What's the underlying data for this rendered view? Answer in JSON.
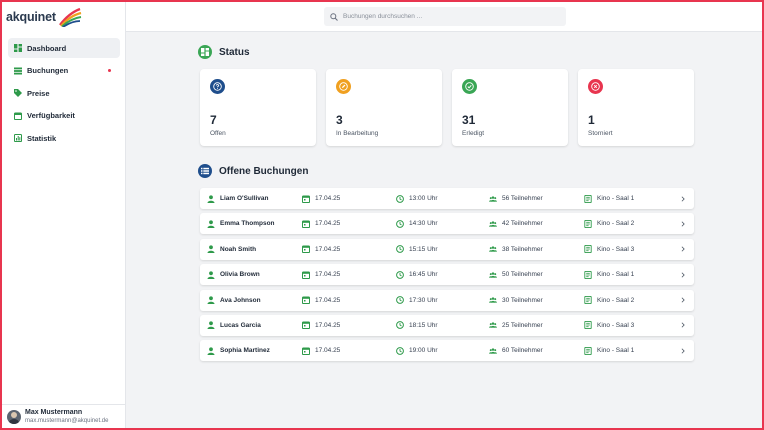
{
  "app": {
    "logo_text": "akquinet"
  },
  "search": {
    "placeholder": "Buchungen durchsuchen ..."
  },
  "sidebar": {
    "items": [
      {
        "label": "Dashboard",
        "icon": "dashboard-icon",
        "active": true
      },
      {
        "label": "Buchungen",
        "icon": "list-icon",
        "badge": true
      },
      {
        "label": "Preise",
        "icon": "tag-icon"
      },
      {
        "label": "Verfügbarkeit",
        "icon": "calendar-icon"
      },
      {
        "label": "Statistik",
        "icon": "chart-icon"
      }
    ]
  },
  "user": {
    "name": "Max Mustermann",
    "email": "max.mustermann@akquinet.de"
  },
  "status": {
    "title": "Status",
    "cards": [
      {
        "count": "7",
        "label": "Offen",
        "color": "#1f4e8c",
        "icon": "question-icon"
      },
      {
        "count": "3",
        "label": "In Bearbeitung",
        "color": "#f0a020",
        "icon": "edit-icon"
      },
      {
        "count": "31",
        "label": "Erledigt",
        "color": "#3aa655",
        "icon": "check-icon"
      },
      {
        "count": "1",
        "label": "Storniert",
        "color": "#e8354f",
        "icon": "cancel-icon"
      }
    ]
  },
  "bookings": {
    "title": "Offene Buchungen",
    "rows": [
      {
        "name": "Liam O'Sullivan",
        "date": "17.04.25",
        "time": "13:00 Uhr",
        "participants": "56 Teilnehmer",
        "room": "Kino - Saal 1"
      },
      {
        "name": "Emma Thompson",
        "date": "17.04.25",
        "time": "14:30 Uhr",
        "participants": "42 Teilnehmer",
        "room": "Kino - Saal 2"
      },
      {
        "name": "Noah Smith",
        "date": "17.04.25",
        "time": "15:15 Uhr",
        "participants": "38 Teilnehmer",
        "room": "Kino - Saal 3"
      },
      {
        "name": "Olivia Brown",
        "date": "17.04.25",
        "time": "16:45 Uhr",
        "participants": "50 Teilnehmer",
        "room": "Kino - Saal 1"
      },
      {
        "name": "Ava Johnson",
        "date": "17.04.25",
        "time": "17:30 Uhr",
        "participants": "30 Teilnehmer",
        "room": "Kino - Saal 2"
      },
      {
        "name": "Lucas Garcia",
        "date": "17.04.25",
        "time": "18:15 Uhr",
        "participants": "25 Teilnehmer",
        "room": "Kino - Saal 3"
      },
      {
        "name": "Sophia Martinez",
        "date": "17.04.25",
        "time": "19:00 Uhr",
        "participants": "60 Teilnehmer",
        "room": "Kino - Saal 1"
      }
    ]
  },
  "colors": {
    "accent_green": "#2e9a4a",
    "brand_blue": "#1f4e8c",
    "alert_red": "#e8354f"
  }
}
